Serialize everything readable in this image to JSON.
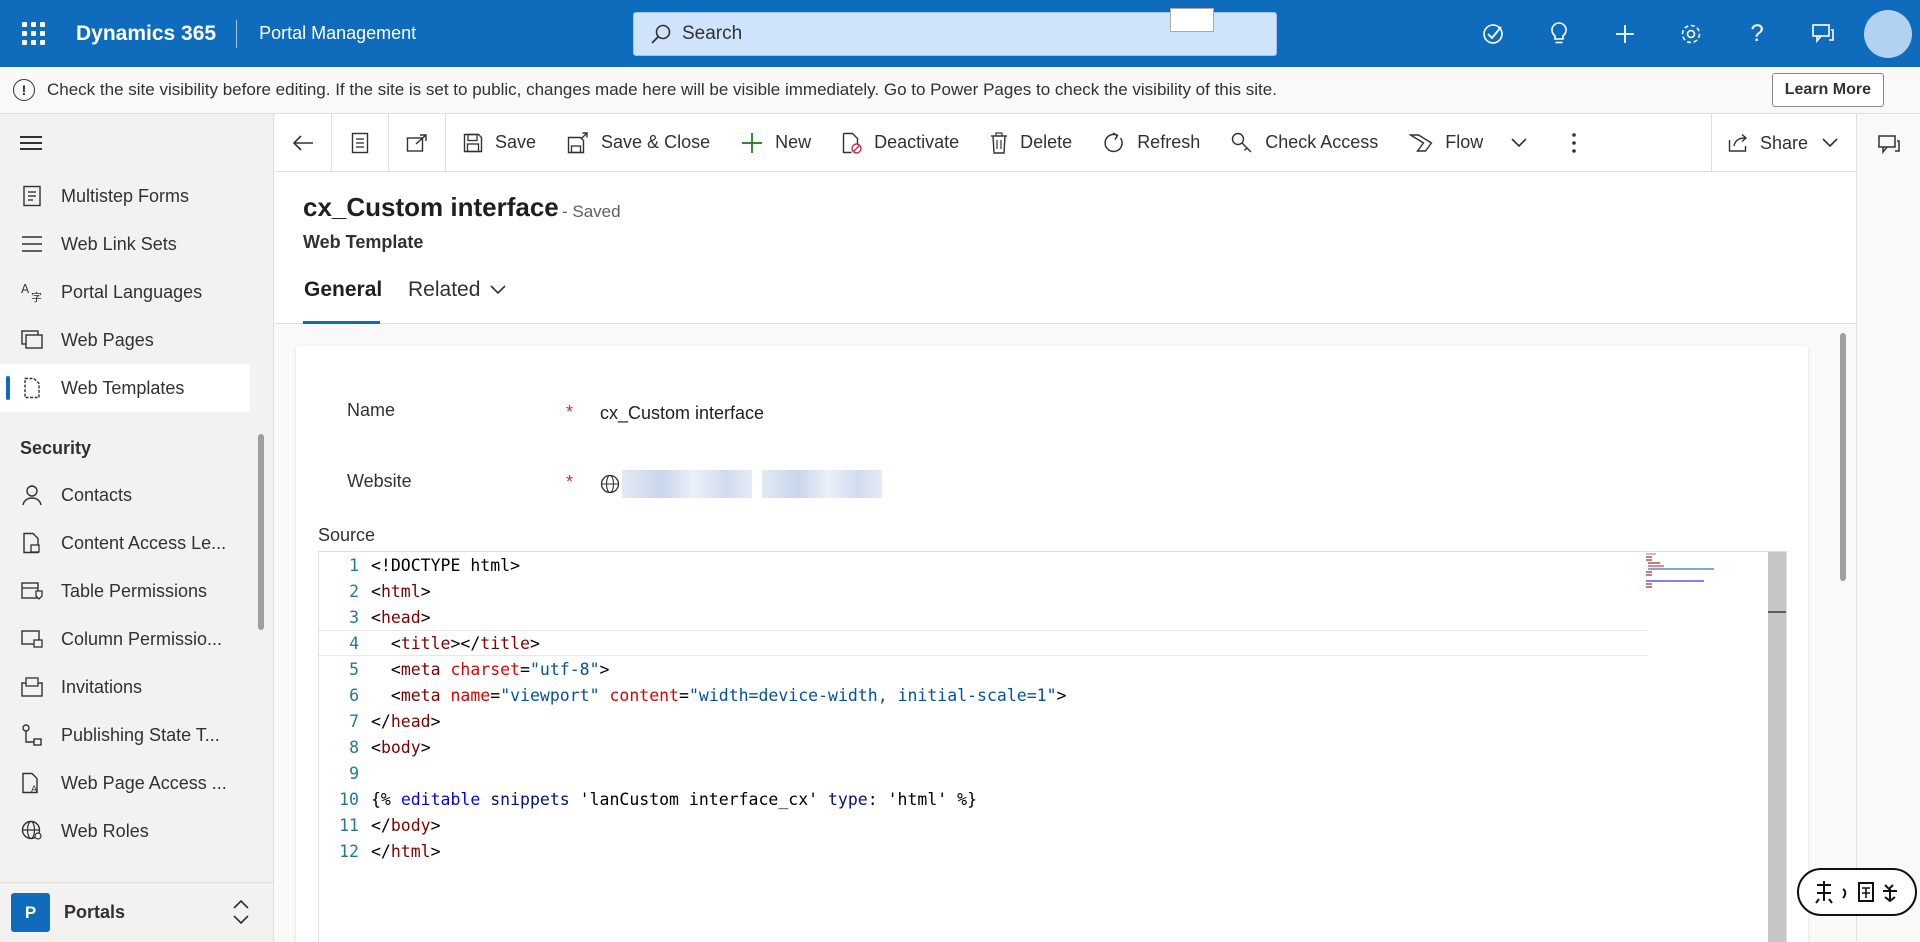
{
  "topbar": {
    "app_name": "Dynamics 365",
    "area_name": "Portal Management",
    "search_placeholder": "Search",
    "icons": [
      "assistant-icon",
      "lightbulb-icon",
      "plus-icon",
      "gear-icon",
      "help-icon",
      "chat-icon"
    ]
  },
  "notice": {
    "text": "Check the site visibility before editing. If the site is set to public, changes made here will be visible immediately. Go to Power Pages to check the visibility of this site.",
    "learn_more": "Learn More"
  },
  "sidebar": {
    "items_top": [
      {
        "label": "Multistep Forms",
        "icon": "form-steps-icon"
      },
      {
        "label": "Web Link Sets",
        "icon": "list-icon"
      },
      {
        "label": "Portal Languages",
        "icon": "language-icon"
      },
      {
        "label": "Web Pages",
        "icon": "pages-icon"
      },
      {
        "label": "Web Templates",
        "icon": "template-icon",
        "selected": true
      }
    ],
    "section_security": "Security",
    "items_security": [
      {
        "label": "Contacts",
        "icon": "person-icon"
      },
      {
        "label": "Content Access Le...",
        "icon": "doc-lock-icon"
      },
      {
        "label": "Table Permissions",
        "icon": "table-shield-icon"
      },
      {
        "label": "Column Permissio...",
        "icon": "column-lock-icon"
      },
      {
        "label": "Invitations",
        "icon": "invitation-icon"
      },
      {
        "label": "Publishing State T...",
        "icon": "flow-state-icon"
      },
      {
        "label": "Web Page Access ...",
        "icon": "page-access-icon"
      },
      {
        "label": "Web Roles",
        "icon": "globe-person-icon"
      }
    ],
    "area": {
      "badge": "P",
      "label": "Portals"
    }
  },
  "cmdbar": {
    "save": "Save",
    "save_close": "Save & Close",
    "new": "New",
    "deactivate": "Deactivate",
    "delete": "Delete",
    "refresh": "Refresh",
    "check_access": "Check Access",
    "flow": "Flow",
    "share": "Share"
  },
  "record": {
    "title": "cx_Custom interface",
    "status": "- Saved",
    "entity": "Web Template",
    "tabs": {
      "general": "General",
      "related": "Related"
    }
  },
  "form": {
    "name_label": "Name",
    "name_value": "cx_Custom interface",
    "website_label": "Website",
    "required_marker": "*",
    "source_label": "Source"
  },
  "code_lines": [
    {
      "num": "1",
      "tokens": [
        {
          "t": "<!DOCTYPE html>",
          "c": "plain"
        }
      ]
    },
    {
      "num": "2",
      "tokens": [
        {
          "t": "<",
          "c": "plain"
        },
        {
          "t": "html",
          "c": "tag"
        },
        {
          "t": ">",
          "c": "plain"
        }
      ]
    },
    {
      "num": "3",
      "tokens": [
        {
          "t": "<",
          "c": "plain"
        },
        {
          "t": "head",
          "c": "tag"
        },
        {
          "t": ">",
          "c": "plain"
        }
      ]
    },
    {
      "num": "4",
      "tokens": [
        {
          "t": "  <",
          "c": "plain"
        },
        {
          "t": "title",
          "c": "tag"
        },
        {
          "t": "></",
          "c": "plain"
        },
        {
          "t": "title",
          "c": "tag"
        },
        {
          "t": ">",
          "c": "plain"
        }
      ],
      "current": true
    },
    {
      "num": "5",
      "tokens": [
        {
          "t": "  <",
          "c": "plain"
        },
        {
          "t": "meta",
          "c": "tag"
        },
        {
          "t": " ",
          "c": "plain"
        },
        {
          "t": "charset",
          "c": "attr"
        },
        {
          "t": "=",
          "c": "plain"
        },
        {
          "t": "\"utf-8\"",
          "c": "str"
        },
        {
          "t": ">",
          "c": "plain"
        }
      ]
    },
    {
      "num": "6",
      "tokens": [
        {
          "t": "  <",
          "c": "plain"
        },
        {
          "t": "meta",
          "c": "tag"
        },
        {
          "t": " ",
          "c": "plain"
        },
        {
          "t": "name",
          "c": "attr"
        },
        {
          "t": "=",
          "c": "plain"
        },
        {
          "t": "\"viewport\"",
          "c": "str"
        },
        {
          "t": " ",
          "c": "plain"
        },
        {
          "t": "content",
          "c": "attr"
        },
        {
          "t": "=",
          "c": "plain"
        },
        {
          "t": "\"width=device-width, initial-scale=1\"",
          "c": "str"
        },
        {
          "t": ">",
          "c": "plain"
        }
      ]
    },
    {
      "num": "7",
      "tokens": [
        {
          "t": "</",
          "c": "plain"
        },
        {
          "t": "head",
          "c": "tag"
        },
        {
          "t": ">",
          "c": "plain"
        }
      ]
    },
    {
      "num": "8",
      "tokens": [
        {
          "t": "<",
          "c": "plain"
        },
        {
          "t": "body",
          "c": "tag"
        },
        {
          "t": ">",
          "c": "plain"
        }
      ]
    },
    {
      "num": "9",
      "tokens": []
    },
    {
      "num": "10",
      "tokens": [
        {
          "t": "{% ",
          "c": "plain"
        },
        {
          "t": "editable",
          "c": "kw"
        },
        {
          "t": " ",
          "c": "plain"
        },
        {
          "t": "snippets",
          "c": "var"
        },
        {
          "t": " 'lanCustom interface_cx' ",
          "c": "plain"
        },
        {
          "t": "type",
          "c": "var"
        },
        {
          "t": ": 'html' %}",
          "c": "plain"
        }
      ]
    },
    {
      "num": "11",
      "tokens": [
        {
          "t": "</",
          "c": "plain"
        },
        {
          "t": "body",
          "c": "tag"
        },
        {
          "t": ">",
          "c": "plain"
        }
      ]
    },
    {
      "num": "12",
      "tokens": [
        {
          "t": "</",
          "c": "plain"
        },
        {
          "t": "html",
          "c": "tag"
        },
        {
          "t": ">",
          "c": "plain"
        }
      ]
    }
  ],
  "colors": {
    "brand": "#0f6cbd",
    "required": "#c4314b"
  }
}
